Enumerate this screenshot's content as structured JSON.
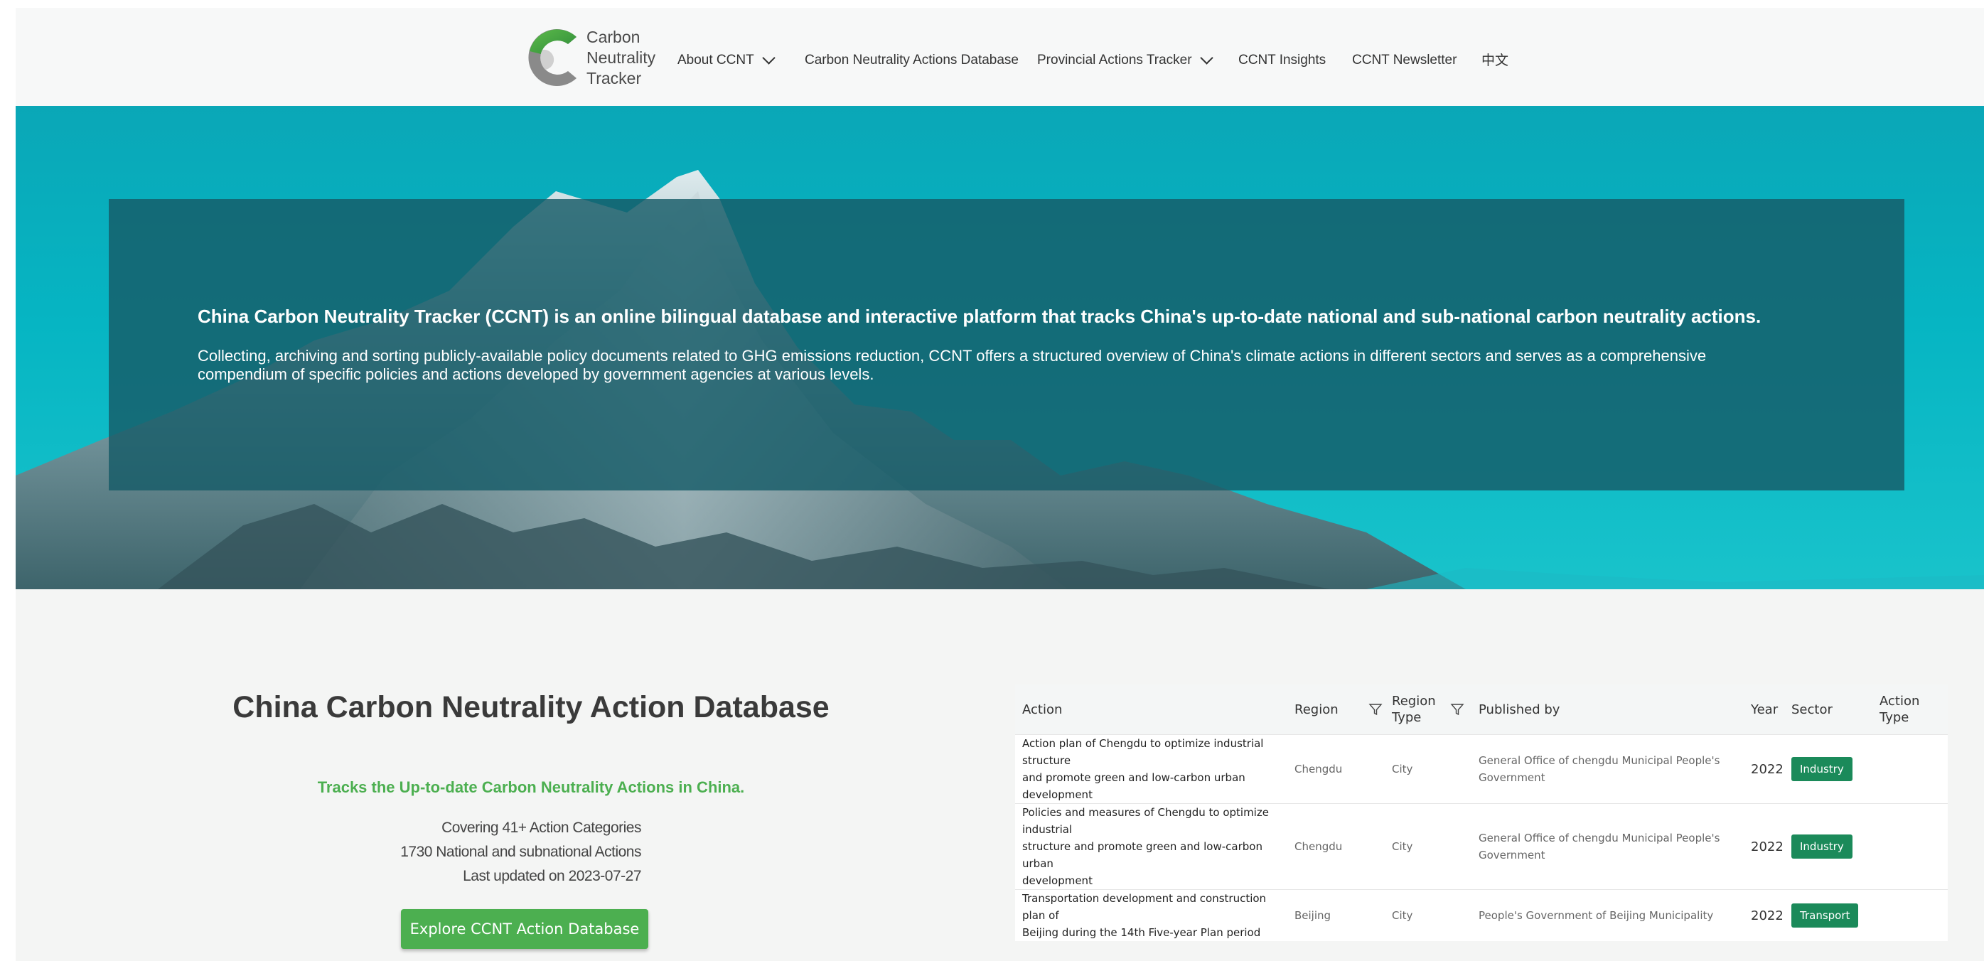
{
  "logo": {
    "line1": "Carbon",
    "line2": "Neutrality",
    "line3": "Tracker"
  },
  "nav": {
    "about": "About CCNT",
    "database": "Carbon Neutrality Actions Database",
    "provincial": "Provincial Actions Tracker",
    "insights": "CCNT Insights",
    "newsletter": "CCNT Newsletter",
    "lang": "中文"
  },
  "hero": {
    "title": "China Carbon Neutrality Tracker (CCNT) is an online bilingual database and interactive platform that tracks China's up-to-date national and sub-national carbon neutrality actions.",
    "description": "Collecting, archiving and sorting publicly-available policy documents related to GHG emissions reduction, CCNT offers a structured overview of China's climate actions in different sectors and serves as a comprehensive compendium of specific policies and actions developed by government agencies at various levels."
  },
  "database": {
    "title": "China Carbon Neutrality Action Database",
    "tagline": "Tracks the Up-to-date Carbon Neutrality Actions in China.",
    "stat1": "Covering 41+ Action Categories",
    "stat2": "1730 National and subnational Actions",
    "stat3": "Last updated on 2023-07-27",
    "button": "Explore CCNT Action Database"
  },
  "table": {
    "headers": {
      "action": "Action",
      "region": "Region",
      "region_type_1": "Region",
      "region_type_2": "Type",
      "published_by": "Published by",
      "year": "Year",
      "sector": "Sector",
      "action_type_1": "Action",
      "action_type_2": "Type"
    },
    "rows": [
      {
        "action_1": "Action plan of Chengdu to optimize industrial structure",
        "action_2": "and promote green and low-carbon urban development",
        "region": "Chengdu",
        "region_type": "City",
        "published_1": "General Office of chengdu Municipal People's",
        "published_2": "Government",
        "year": "2022",
        "sector": "Industry",
        "action_type": ""
      },
      {
        "action_1": "Policies and measures of Chengdu to optimize industrial",
        "action_2": "structure and promote green and low-carbon urban",
        "action_3": "development",
        "region": "Chengdu",
        "region_type": "City",
        "published_1": "General Office of chengdu Municipal People's",
        "published_2": "Government",
        "year": "2022",
        "sector": "Industry",
        "action_type": ""
      },
      {
        "action_1": "Transportation development and construction plan of",
        "action_2": "Beijing during the 14th Five-year Plan period",
        "region": "Beijing",
        "region_type": "City",
        "published_1": "People's Government of Beijing Municipality",
        "year": "2022",
        "sector": "Transport",
        "action_type": ""
      }
    ]
  },
  "colors": {
    "accent_green": "#4caf50",
    "sector_badge": "#1b8a5a",
    "hero_panel": "#165c68",
    "hero_sky": "#06b5c3"
  }
}
